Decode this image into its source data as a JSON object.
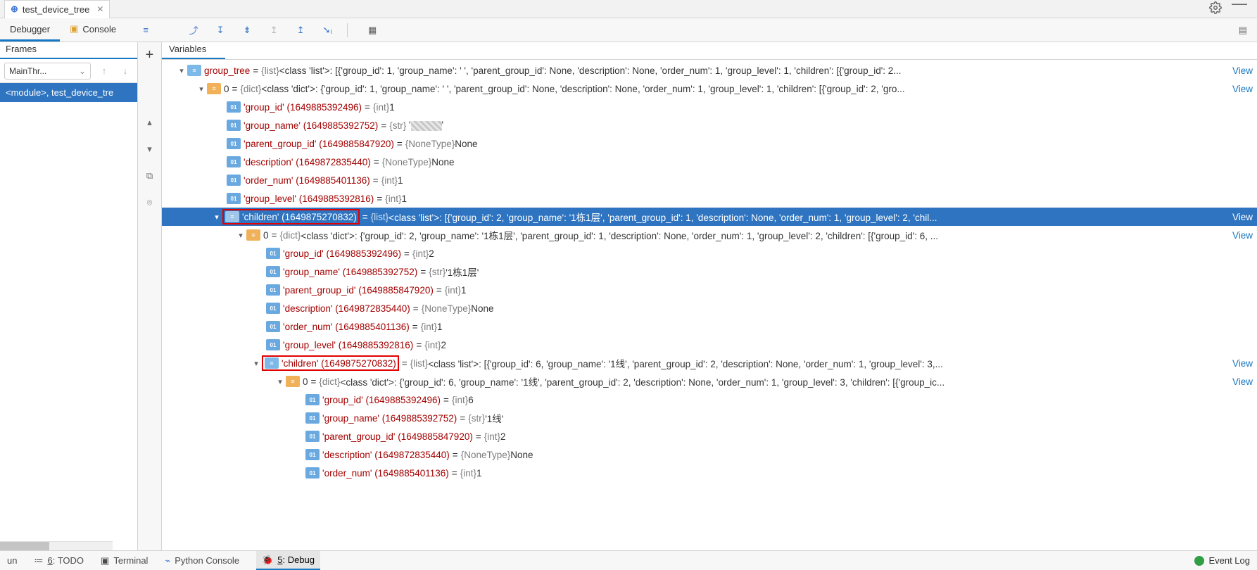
{
  "tabs": {
    "file": "test_device_tree"
  },
  "debugger": {
    "tab_debugger": "Debugger",
    "tab_console": "Console"
  },
  "frames": {
    "header": "Frames",
    "thread": "MainThr...",
    "row": "<module>, test_device_tre"
  },
  "variables": {
    "header": "Variables",
    "view_link": "View",
    "group_tree": {
      "name": "group_tree",
      "eq": " = ",
      "type": "{list}",
      "value": " <class 'list'>: [{'group_id': 1, 'group_name': '      ', 'parent_group_id': None, 'description': None, 'order_num': 1, 'group_level': 1, 'children': [{'group_id': 2..."
    },
    "item0": {
      "name": "0",
      "eq": " = ",
      "type": "{dict}",
      "value": " <class 'dict'>: {'group_id': 1, 'group_name': '      ', 'parent_group_id': None, 'description': None, 'order_num': 1, 'group_level': 1, 'children': [{'group_id': 2, 'gro..."
    },
    "leaf_group_id_1": {
      "name": "'group_id' (1649885392496)",
      "type": "{int}",
      "value": " 1"
    },
    "leaf_group_name_1": {
      "name": "'group_name' (1649885392752)",
      "type": "{str}",
      "value_censored": true
    },
    "leaf_parent_1": {
      "name": "'parent_group_id' (1649885847920)",
      "type": "{NoneType}",
      "value": " None"
    },
    "leaf_desc_1": {
      "name": "'description' (1649872835440)",
      "type": "{NoneType}",
      "value": " None"
    },
    "leaf_order_1": {
      "name": "'order_num' (1649885401136)",
      "type": "{int}",
      "value": " 1"
    },
    "leaf_level_1": {
      "name": "'group_level' (1649885392816)",
      "type": "{int}",
      "value": " 1"
    },
    "children_sel": {
      "name": "'children' (1649875270832)",
      "eq": " = ",
      "type": "{list}",
      "value": " <class 'list'>: [{'group_id': 2, 'group_name': '1栋1层', 'parent_group_id': 1, 'description': None, 'order_num': 1, 'group_level': 2, 'chil..."
    },
    "item0b": {
      "name": "0",
      "eq": " = ",
      "type": "{dict}",
      "value": " <class 'dict'>: {'group_id': 2, 'group_name': '1栋1层', 'parent_group_id': 1, 'description': None, 'order_num': 1, 'group_level': 2, 'children': [{'group_id': 6, ..."
    },
    "leaf_group_id_2": {
      "name": "'group_id' (1649885392496)",
      "type": "{int}",
      "value": " 2"
    },
    "leaf_group_name_2": {
      "name": "'group_name' (1649885392752)",
      "type": "{str}",
      "value": " '1栋1层'"
    },
    "leaf_parent_2": {
      "name": "'parent_group_id' (1649885847920)",
      "type": "{int}",
      "value": " 1"
    },
    "leaf_desc_2": {
      "name": "'description' (1649872835440)",
      "type": "{NoneType}",
      "value": " None"
    },
    "leaf_order_2": {
      "name": "'order_num' (1649885401136)",
      "type": "{int}",
      "value": " 1"
    },
    "leaf_level_2": {
      "name": "'group_level' (1649885392816)",
      "type": "{int}",
      "value": " 2"
    },
    "children_3": {
      "name": "'children' (1649875270832)",
      "eq_partial": "1",
      "eq_close": " = ",
      "type": "{list}",
      "value": " <class 'list'>: [{'group_id': 6, 'group_name': '1线', 'parent_group_id': 2, 'description': None, 'order_num': 1, 'group_level': 3,..."
    },
    "item0c": {
      "name": "0",
      "eq": " = ",
      "type": "{dict}",
      "value": " <class 'dict'>: {'group_id': 6, 'group_name': '1线', 'parent_group_id': 2, 'description': None, 'order_num': 1, 'group_level': 3, 'children': [{'group_ic..."
    },
    "leaf_group_id_3": {
      "name": "'group_id' (1649885392496)",
      "type": "{int}",
      "value": " 6"
    },
    "leaf_group_name_3": {
      "name": "'group_name' (1649885392752)",
      "type": "{str}",
      "value": " '1线'"
    },
    "leaf_parent_3": {
      "name": "'parent_group_id' (1649885847920)",
      "type": "{int}",
      "value": " 2"
    },
    "leaf_desc_3": {
      "name": "'description' (1649872835440)",
      "type": "{NoneType}",
      "value": " None"
    },
    "leaf_order_3": {
      "name": "'order_num' (1649885401136)",
      "type": "{int}",
      "value": " 1"
    }
  },
  "bottom": {
    "run": "un",
    "todo": "6: TODO",
    "terminal": "Terminal",
    "python_console": "Python Console",
    "debug": "5: Debug",
    "event_log": "Event Log"
  }
}
